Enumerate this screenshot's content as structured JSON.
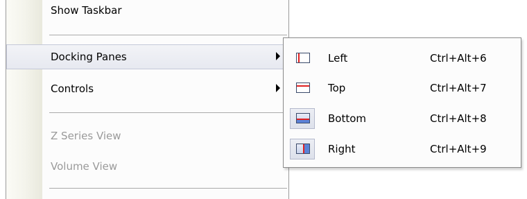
{
  "menu": {
    "items": [
      {
        "label": "Show Taskbar",
        "enabled": true,
        "has_submenu": false,
        "highlighted": false
      },
      {
        "label": "Docking Panes",
        "enabled": true,
        "has_submenu": true,
        "highlighted": true
      },
      {
        "label": "Controls",
        "enabled": true,
        "has_submenu": true,
        "highlighted": false
      },
      {
        "label": "Z Series View",
        "enabled": false,
        "has_submenu": false,
        "highlighted": false
      },
      {
        "label": "Volume View",
        "enabled": false,
        "has_submenu": false,
        "highlighted": false
      }
    ]
  },
  "submenu": {
    "items": [
      {
        "label": "Left",
        "shortcut": "Ctrl+Alt+6",
        "icon": "dock-left-icon",
        "checked": false
      },
      {
        "label": "Top",
        "shortcut": "Ctrl+Alt+7",
        "icon": "dock-top-icon",
        "checked": false
      },
      {
        "label": "Bottom",
        "shortcut": "Ctrl+Alt+8",
        "icon": "dock-bottom-icon",
        "checked": true
      },
      {
        "label": "Right",
        "shortcut": "Ctrl+Alt+9",
        "icon": "dock-right-icon",
        "checked": true
      }
    ]
  },
  "colors": {
    "highlight_border": "#c4c8d8",
    "dock_red": "#e02020",
    "dock_blue": "#5b82d6",
    "disabled_text": "#9a9a9a"
  }
}
